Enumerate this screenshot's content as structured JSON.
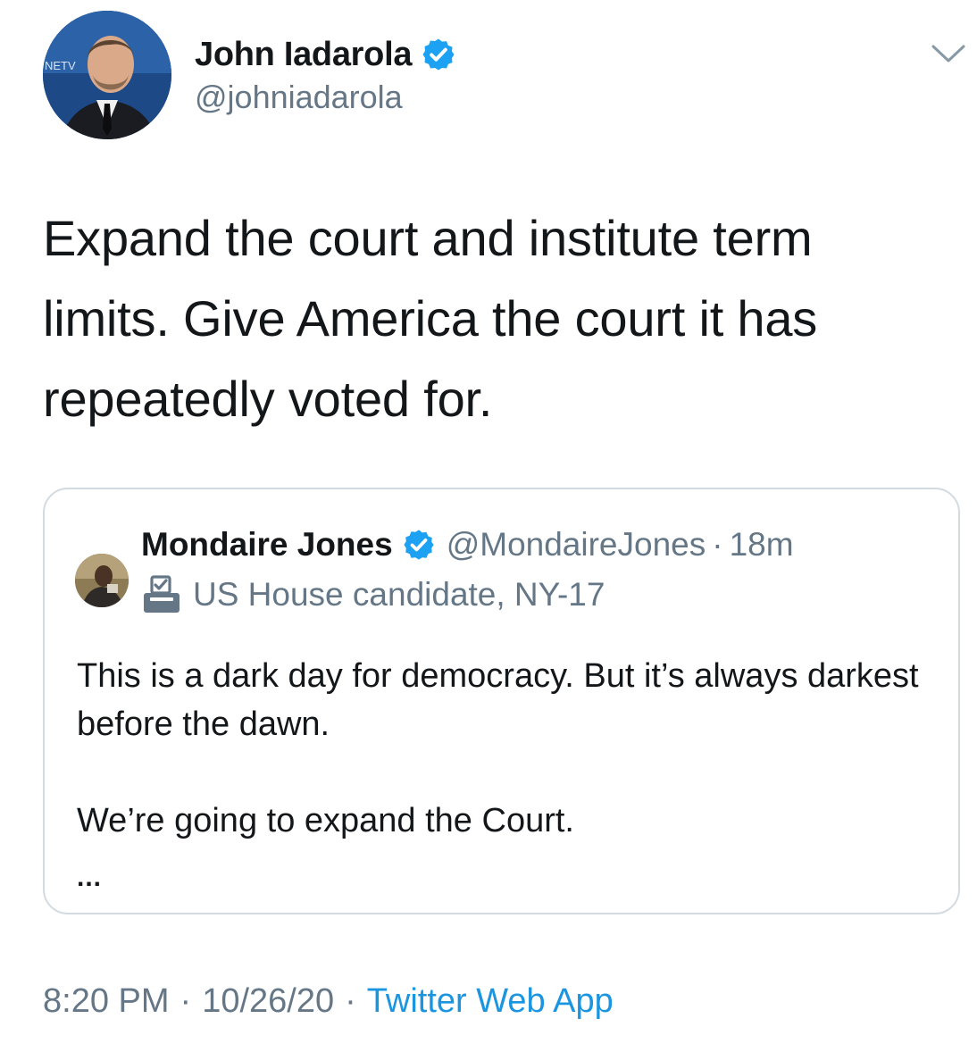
{
  "author": {
    "display_name": "John Iadarola",
    "handle": "@johniadarola",
    "verified": true,
    "avatar_backdrop_text": "NETV"
  },
  "tweet": {
    "text": "Expand the court and institute term limits. Give America the court it has repeatedly voted for."
  },
  "quoted_tweet": {
    "display_name": "Mondaire Jones",
    "verified": true,
    "handle": "@MondaireJones",
    "separator": "·",
    "time": "18m",
    "label": "US House candidate, NY-17",
    "label_icon": "ballot-box-icon",
    "lines": [
      "This is a dark day for democracy. But it’s always darkest before the dawn.",
      "We’re going to expand the Court."
    ],
    "truncation": "..."
  },
  "meta": {
    "time": "8:20 PM",
    "separator": "·",
    "date": "10/26/20",
    "source": "Twitter Web App"
  },
  "colors": {
    "text": "#14171a",
    "secondary": "#657786",
    "accent": "#1b95e0",
    "verified": "#1da1f2",
    "border": "#d4dbe0"
  }
}
